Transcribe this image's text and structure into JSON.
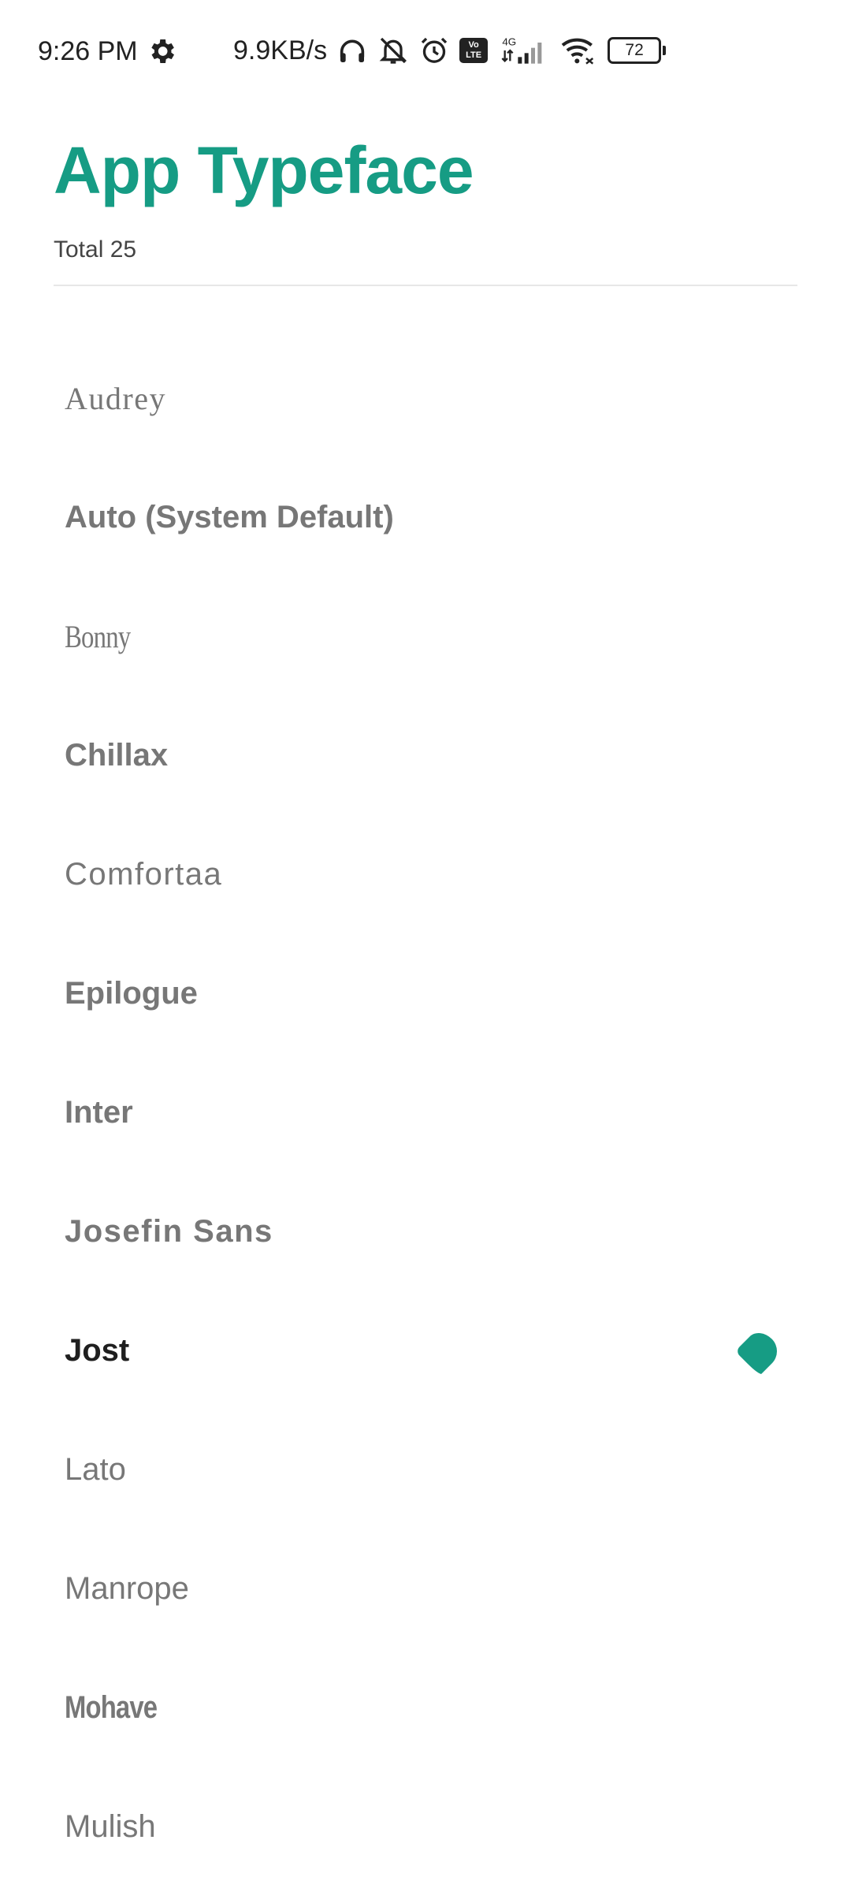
{
  "status_bar": {
    "time": "9:26 PM",
    "network_speed": "9.9KB/s",
    "network_type": "4G",
    "volte_line1": "Vo",
    "volte_line2": "LTE",
    "battery": "72",
    "icons": [
      "settings-gear-icon",
      "headphones-icon",
      "bell-muted-icon",
      "alarm-icon",
      "volte-icon",
      "mobile-signal-icon",
      "wifi-icon",
      "battery-icon"
    ]
  },
  "header": {
    "title": "App Typeface",
    "total": "Total 25"
  },
  "fonts": [
    {
      "label": "Audrey"
    },
    {
      "label": "Auto (System Default)"
    },
    {
      "label": "Bonny"
    },
    {
      "label": "Chillax"
    },
    {
      "label": "Comfortaa"
    },
    {
      "label": "Epilogue"
    },
    {
      "label": "Inter"
    },
    {
      "label": "Josefin Sans"
    },
    {
      "label": "Jost",
      "selected": true
    },
    {
      "label": "Lato"
    },
    {
      "label": "Manrope"
    },
    {
      "label": "Mohave"
    },
    {
      "label": "Mulish"
    }
  ],
  "colors": {
    "accent": "#169c84",
    "text_muted": "#777777",
    "text_selected": "#1f1f1f"
  }
}
